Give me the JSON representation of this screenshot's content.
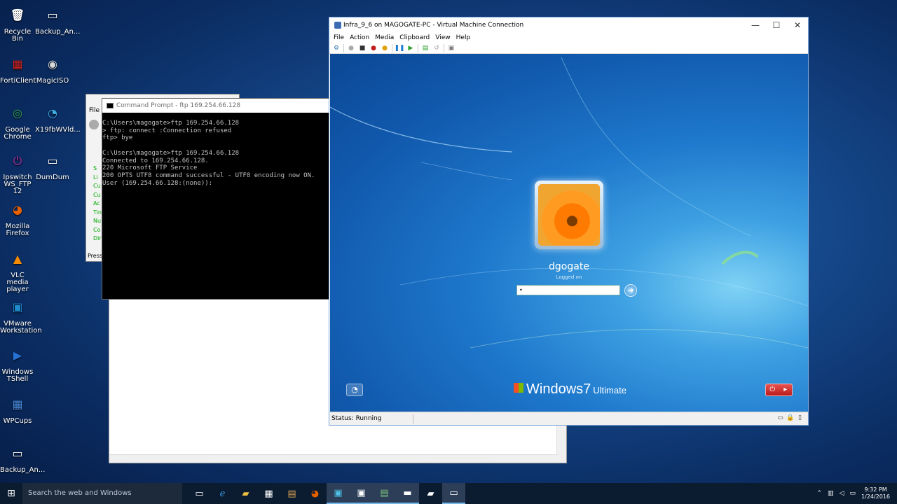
{
  "desktop_icons": [
    {
      "label": "Recycle Bin",
      "glyph": "🗑",
      "color": "#ffffff"
    },
    {
      "label": "Backup_An...",
      "glyph": "▭",
      "color": "#ffffff"
    },
    {
      "label": "FortiClient",
      "glyph": "▦",
      "color": "#d3221f"
    },
    {
      "label": "MagicISO",
      "glyph": "◉",
      "color": "#d9d9d9"
    },
    {
      "label": "Google Chrome",
      "glyph": "◎",
      "color": "#2fa44f"
    },
    {
      "label": "X19fbWVld...",
      "glyph": "◔",
      "color": "#3bb0e6"
    },
    {
      "label": "Ipswitch WS_FTP 12",
      "glyph": "⏻",
      "color": "#7b2d8e"
    },
    {
      "label": "DumDum",
      "glyph": "▭",
      "color": "#ffffff"
    },
    {
      "label": "Mozilla Firefox",
      "glyph": "◕",
      "color": "#e66000"
    },
    {
      "label": "VLC media player",
      "glyph": "▲",
      "color": "#f48b00"
    },
    {
      "label": "VMware Workstation",
      "glyph": "▣",
      "color": "#1f8ccf"
    },
    {
      "label": "Windows TShell",
      "glyph": "▶",
      "color": "#2673d8"
    },
    {
      "label": "WPCups",
      "glyph": "▦",
      "color": "#4a8fe0"
    },
    {
      "label": "Backup_An...",
      "glyph": "▭",
      "color": "#ffffff"
    }
  ],
  "bg_ftp": {
    "menu_label": "File",
    "side_letters": [
      "S",
      "Li",
      "Cu",
      "Cu",
      "Ac",
      "Tin",
      "Nu",
      "Co",
      "Dir"
    ],
    "press_label": "Press"
  },
  "cmd": {
    "title": "Command Prompt - ftp  169.254.66.128",
    "lines": "C:\\Users\\magogate>ftp 169.254.66.128\n> ftp: connect :Connection refused\nftp> bye\n\nC:\\Users\\magogate>ftp 169.254.66.128\nConnected to 169.254.66.128.\n220 Microsoft FTP Service\n200 OPTS UTF8 command successful - UTF8 encoding now ON.\nUser (169.254.66.128:(none)):"
  },
  "vm": {
    "title": "Infra_9_6 on MAGOGATE-PC - Virtual Machine Connection",
    "menu": [
      "File",
      "Action",
      "Media",
      "Clipboard",
      "View",
      "Help"
    ],
    "username": "dgogate",
    "logged_on": "Logged on",
    "password_value": "•",
    "brand": "Windows",
    "brand_version": "7",
    "brand_edition": "Ultimate",
    "status": "Status: Running"
  },
  "taskbar": {
    "search_placeholder": "Search the web and Windows",
    "time": "9:32 PM",
    "date": "1/24/2016"
  }
}
